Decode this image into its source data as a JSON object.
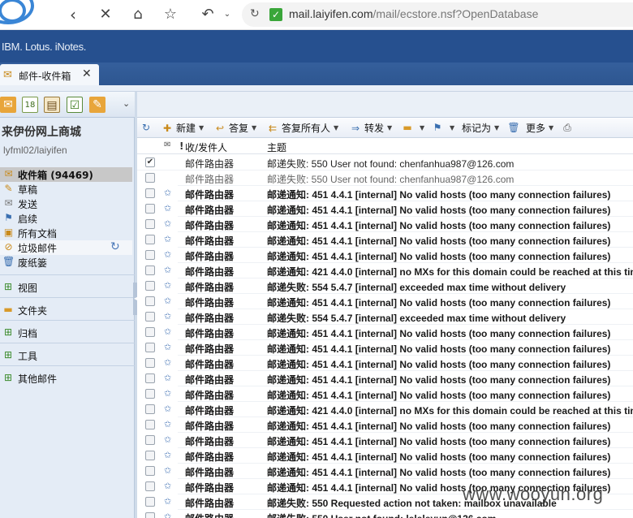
{
  "browser": {
    "url_domain": "mail.laiyifen.com",
    "url_path": "/mail/ecstore.nsf?OpenDatabase"
  },
  "header": {
    "brand": "IBM. Lotus. iNotes."
  },
  "tab": {
    "label": "邮件-收件箱"
  },
  "sidebar": {
    "account_name": "来伊份网上商城",
    "account_id": "lyfml02/laiyifen",
    "folders": [
      {
        "label": "收件箱",
        "count": "(94469)",
        "icon": "inbox-icon"
      },
      {
        "label": "草稿",
        "icon": "drafts-icon"
      },
      {
        "label": "发送",
        "icon": "sent-icon"
      },
      {
        "label": "启续",
        "icon": "followup-icon"
      },
      {
        "label": "所有文档",
        "icon": "all-docs-icon"
      },
      {
        "label": "垃圾邮件",
        "icon": "junk-icon"
      },
      {
        "label": "废纸篓",
        "icon": "trash-icon"
      }
    ],
    "sections": [
      {
        "label": "视图",
        "icon": "views-icon"
      },
      {
        "label": "文件夹",
        "icon": "folder-icon"
      },
      {
        "label": "归档",
        "icon": "archive-icon"
      },
      {
        "label": "工具",
        "icon": "tools-icon"
      },
      {
        "label": "其他邮件",
        "icon": "other-mail-icon"
      }
    ]
  },
  "toolbar": {
    "new": "新建",
    "reply": "答复",
    "reply_all": "答复所有人",
    "forward": "转发",
    "mark_as": "标记为",
    "more": "更多"
  },
  "columns": {
    "from": "收/发件人",
    "subject": "主题",
    "importance": "!"
  },
  "messages": [
    {
      "from": "邮件路由器",
      "subject": "邮递失败: 550 User not found: chenfanhua987@126.com",
      "state": "selected",
      "checked": true
    },
    {
      "from": "邮件路由器",
      "subject": "邮递失败: 550 User not found: chenfanhua987@126.com",
      "state": "read",
      "checked": false
    },
    {
      "from": "邮件路由器",
      "subject": "邮递通知: 451 4.4.1 [internal] No valid hosts (too many connection failures)",
      "state": "unread"
    },
    {
      "from": "邮件路由器",
      "subject": "邮递通知: 451 4.4.1 [internal] No valid hosts (too many connection failures)",
      "state": "unread"
    },
    {
      "from": "邮件路由器",
      "subject": "邮递通知: 451 4.4.1 [internal] No valid hosts (too many connection failures)",
      "state": "unread"
    },
    {
      "from": "邮件路由器",
      "subject": "邮递通知: 451 4.4.1 [internal] No valid hosts (too many connection failures)",
      "state": "unread"
    },
    {
      "from": "邮件路由器",
      "subject": "邮递通知: 451 4.4.1 [internal] No valid hosts (too many connection failures)",
      "state": "unread"
    },
    {
      "from": "邮件路由器",
      "subject": "邮递通知: 421 4.4.0 [internal] no MXs for this domain could be reached at this time",
      "state": "unread"
    },
    {
      "from": "邮件路由器",
      "subject": "邮递失败: 554 5.4.7 [internal] exceeded max time without delivery",
      "state": "unread"
    },
    {
      "from": "邮件路由器",
      "subject": "邮递通知: 451 4.4.1 [internal] No valid hosts (too many connection failures)",
      "state": "unread"
    },
    {
      "from": "邮件路由器",
      "subject": "邮递失败: 554 5.4.7 [internal] exceeded max time without delivery",
      "state": "unread"
    },
    {
      "from": "邮件路由器",
      "subject": "邮递通知: 451 4.4.1 [internal] No valid hosts (too many connection failures)",
      "state": "unread"
    },
    {
      "from": "邮件路由器",
      "subject": "邮递通知: 451 4.4.1 [internal] No valid hosts (too many connection failures)",
      "state": "unread"
    },
    {
      "from": "邮件路由器",
      "subject": "邮递通知: 451 4.4.1 [internal] No valid hosts (too many connection failures)",
      "state": "unread"
    },
    {
      "from": "邮件路由器",
      "subject": "邮递通知: 451 4.4.1 [internal] No valid hosts (too many connection failures)",
      "state": "unread"
    },
    {
      "from": "邮件路由器",
      "subject": "邮递通知: 451 4.4.1 [internal] No valid hosts (too many connection failures)",
      "state": "unread"
    },
    {
      "from": "邮件路由器",
      "subject": "邮递通知: 421 4.4.0 [internal] no MXs for this domain could be reached at this time",
      "state": "unread"
    },
    {
      "from": "邮件路由器",
      "subject": "邮递通知: 451 4.4.1 [internal] No valid hosts (too many connection failures)",
      "state": "unread"
    },
    {
      "from": "邮件路由器",
      "subject": "邮递通知: 451 4.4.1 [internal] No valid hosts (too many connection failures)",
      "state": "unread"
    },
    {
      "from": "邮件路由器",
      "subject": "邮递通知: 451 4.4.1 [internal] No valid hosts (too many connection failures)",
      "state": "unread"
    },
    {
      "from": "邮件路由器",
      "subject": "邮递通知: 451 4.4.1 [internal] No valid hosts (too many connection failures)",
      "state": "unread"
    },
    {
      "from": "邮件路由器",
      "subject": "邮递通知: 451 4.4.1 [internal] No valid hosts (too many connection failures)",
      "state": "unread"
    },
    {
      "from": "邮件路由器",
      "subject": "邮递失败: 550 Requested action not taken: mailbox unavailable",
      "state": "unread"
    },
    {
      "from": "邮件路由器",
      "subject": "邮递失败: 550 User not found: leleleyun@126.com",
      "state": "unread"
    },
    {
      "from": "邮件路由器",
      "subject": "邮递通知: 451 4.4.1 [internal] No valid hosts (too many connection failures)",
      "state": "unread"
    }
  ],
  "watermark": "www.wooyun.org",
  "colors": {
    "header_blue": "#26508f",
    "selection": "#5e9de4",
    "sidebar_bg": "#e4ecf6"
  }
}
